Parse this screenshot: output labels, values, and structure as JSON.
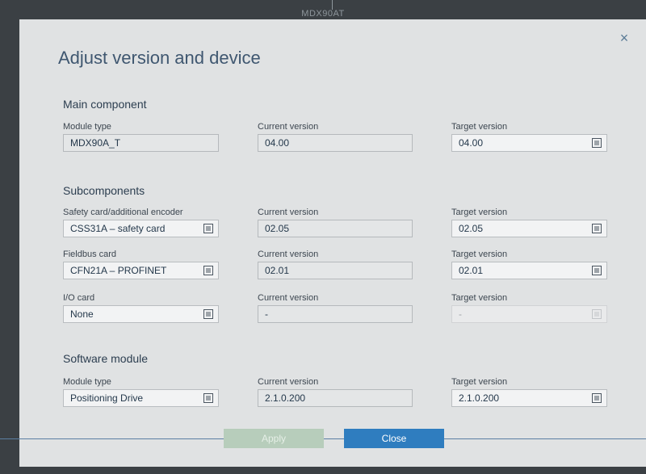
{
  "backdrop": {
    "title": "MDX90AT"
  },
  "dialog": {
    "title": "Adjust version and device",
    "close_symbol": "×"
  },
  "main": {
    "section_title": "Main component",
    "module_type_label": "Module type",
    "module_type_value": "MDX90A_T",
    "current_label": "Current version",
    "current_value": "04.00",
    "target_label": "Target version",
    "target_value": "04.00"
  },
  "sub": {
    "section_title": "Subcomponents",
    "safety": {
      "label": "Safety card/additional encoder",
      "value": "CSS31A – safety card",
      "current_label": "Current version",
      "current_value": "02.05",
      "target_label": "Target version",
      "target_value": "02.05"
    },
    "fieldbus": {
      "label": "Fieldbus card",
      "value": "CFN21A – PROFINET",
      "current_label": "Current version",
      "current_value": "02.01",
      "target_label": "Target version",
      "target_value": "02.01"
    },
    "io": {
      "label": "I/O card",
      "value": "None",
      "current_label": "Current version",
      "current_value": "-",
      "target_label": "Target version",
      "target_value": "-"
    }
  },
  "software": {
    "section_title": "Software module",
    "module_type_label": "Module type",
    "module_type_value": "Positioning Drive",
    "current_label": "Current version",
    "current_value": "2.1.0.200",
    "target_label": "Target version",
    "target_value": "2.1.0.200"
  },
  "buttons": {
    "apply": "Apply",
    "close": "Close"
  },
  "icons": {
    "list": "list-icon",
    "close": "close-icon"
  },
  "colors": {
    "accent": "#2f7dbf",
    "apply_disabled": "#b7cdbb",
    "dialog_bg": "#e0e2e3"
  }
}
